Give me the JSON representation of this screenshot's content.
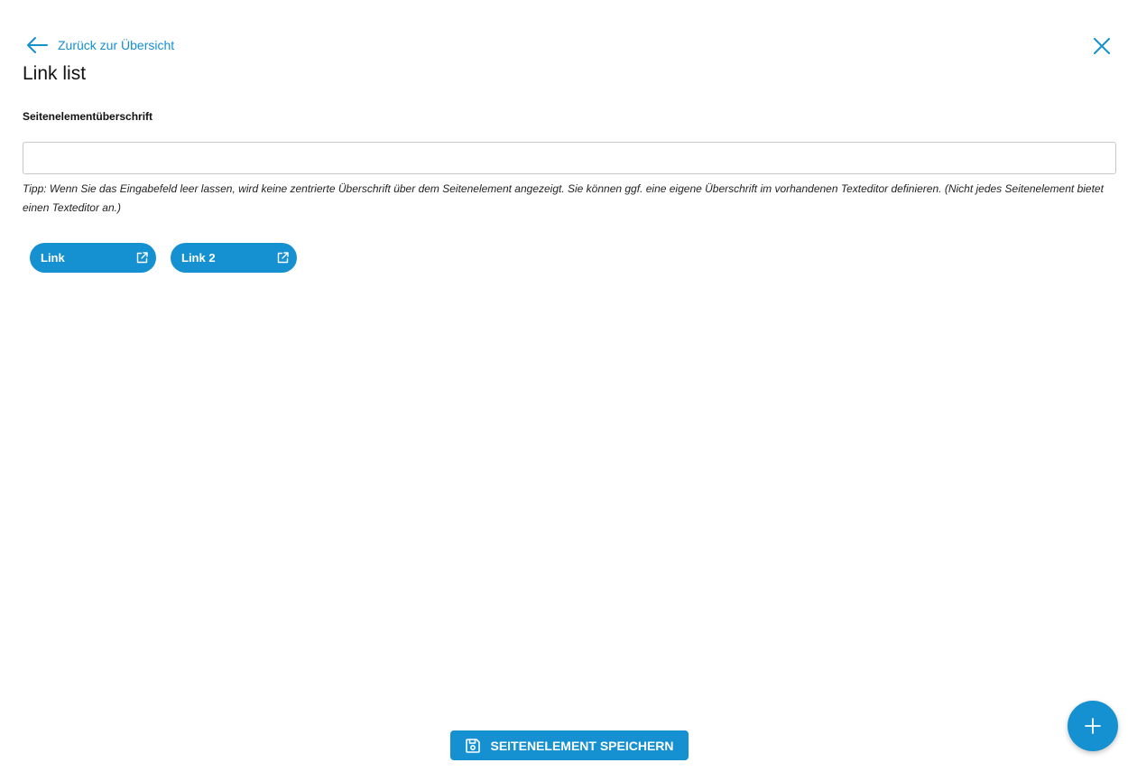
{
  "header": {
    "back_label": "Zurück zur Übersicht",
    "title": "Link list"
  },
  "form": {
    "heading_label": "Seitenelementüberschrift",
    "heading_value": "",
    "hint": "Tipp: Wenn Sie das Eingabefeld leer lassen, wird keine zentrierte Überschrift über dem Seitenelement angezeigt. Sie können ggf. eine eigene Überschrift im vorhandenen Texteditor definieren. (Nicht jedes Seitenelement bietet einen Texteditor an.)"
  },
  "links": [
    {
      "label": "Link",
      "icon": "external-link-icon"
    },
    {
      "label": "Link 2",
      "icon": "external-link-icon"
    }
  ],
  "footer": {
    "save_label": "SEITENELEMENT SPEICHERN",
    "save_icon": "save-icon",
    "fab_icon": "plus-icon"
  },
  "icons": {
    "back": "arrow-left-icon",
    "close": "close-icon"
  },
  "colors": {
    "accent": "#1590d0",
    "text": "#111111",
    "border": "#c9c9c9"
  }
}
